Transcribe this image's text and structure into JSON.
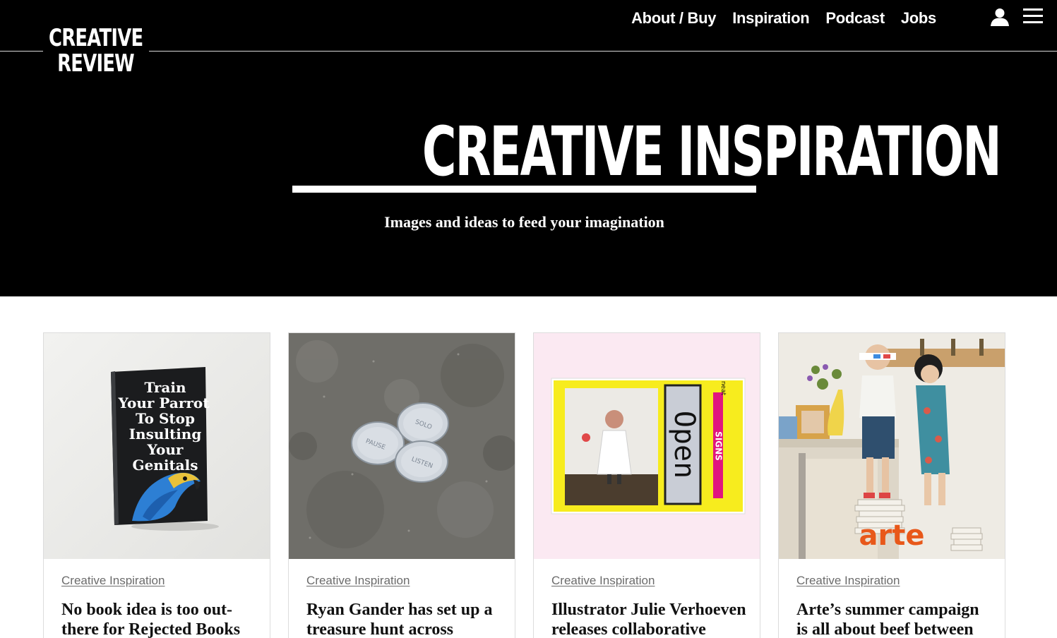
{
  "header": {
    "logo_line1": "CREATIVE",
    "logo_line2": "REVIEW",
    "nav": [
      {
        "label": "About / Buy"
      },
      {
        "label": "Inspiration"
      },
      {
        "label": "Podcast"
      },
      {
        "label": "Jobs"
      }
    ],
    "icons": [
      "user-icon",
      "hamburger-menu-icon"
    ]
  },
  "hero": {
    "title": "CREATIVE INSPIRATION",
    "subtitle": "Images and ideas to feed your imagination"
  },
  "colors": {
    "header_bg": "#000000",
    "text_on_dark": "#ffffff",
    "category_text": "#6b6b6b"
  },
  "cards": [
    {
      "category": "Creative Inspiration",
      "headline": "No book idea is too out-there for Rejected Books",
      "image": {
        "book_title_lines": [
          "Train",
          "Your Parrot",
          "To Stop",
          "Insulting",
          "Your",
          "Genitals"
        ]
      }
    },
    {
      "category": "Creative Inspiration",
      "headline": "Ryan Gander has set up a treasure hunt across",
      "image": {
        "coin_labels": [
          "PAUSE",
          "SOLO",
          "LISTEN"
        ]
      }
    },
    {
      "category": "Creative Inspiration",
      "headline": "Illustrator Julie Verhoeven releases collaborative",
      "image": {
        "sign_word": "Open",
        "side_label": "SIGNS",
        "small_label": "neat"
      }
    },
    {
      "category": "Creative Inspiration",
      "headline": "Arte’s summer campaign is all about beef between",
      "image": {
        "brand_text": "arte"
      }
    }
  ]
}
